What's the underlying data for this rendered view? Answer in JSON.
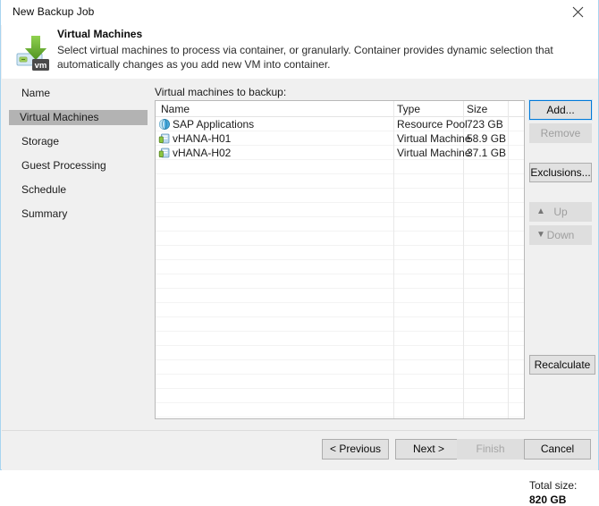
{
  "window": {
    "title": "New Backup Job",
    "close_icon": "close-icon"
  },
  "header": {
    "icon": "vm-download-icon",
    "title": "Virtual Machines",
    "description": "Select virtual machines to process via container, or granularly. Container provides dynamic selection that automatically changes as you add new VM into container."
  },
  "sidebar": {
    "items": [
      {
        "label": "Name",
        "selected": false
      },
      {
        "label": "Virtual Machines",
        "selected": true
      },
      {
        "label": "Storage",
        "selected": false
      },
      {
        "label": "Guest Processing",
        "selected": false
      },
      {
        "label": "Schedule",
        "selected": false
      },
      {
        "label": "Summary",
        "selected": false
      }
    ]
  },
  "main": {
    "list_label": "Virtual machines to backup:",
    "columns": [
      "Name",
      "Type",
      "Size"
    ],
    "rows": [
      {
        "icon": "resource-pool-icon",
        "name": "SAP Applications",
        "type": "Resource Pool",
        "size": "723 GB"
      },
      {
        "icon": "virtual-machine-icon",
        "name": "vHANA-H01",
        "type": "Virtual Machine",
        "size": "58.9 GB"
      },
      {
        "icon": "virtual-machine-icon",
        "name": "vHANA-H02",
        "type": "Virtual Machine",
        "size": "37.1 GB"
      }
    ]
  },
  "actions": {
    "add": "Add...",
    "remove": "Remove",
    "exclusions": "Exclusions...",
    "up": "Up",
    "down": "Down",
    "up_icon": "arrow-up-icon",
    "down_icon": "arrow-down-icon",
    "recalculate": "Recalculate"
  },
  "summary": {
    "total_label": "Total size:",
    "total_value": "820 GB"
  },
  "footer": {
    "previous": "< Previous",
    "next": "Next >",
    "finish": "Finish",
    "cancel": "Cancel"
  },
  "colors": {
    "accent": "#0078d7",
    "selection": "#b3b3b3",
    "dialog_bg": "#f0f0f0",
    "border": "#a8d4f0"
  }
}
